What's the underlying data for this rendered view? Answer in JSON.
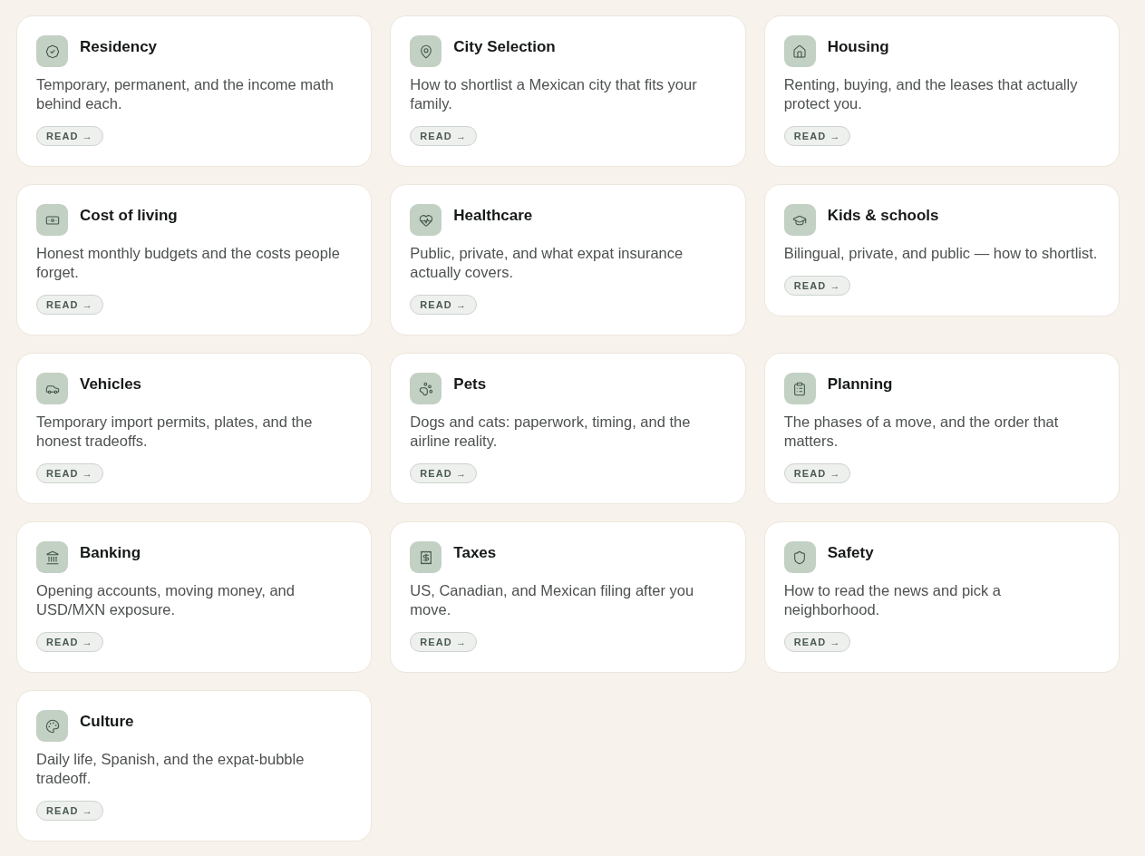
{
  "cards": [
    {
      "title": "Residency",
      "description": "Temporary, permanent, and the income math behind each.",
      "action": "READ →"
    },
    {
      "title": "City Selection",
      "description": "How to shortlist a Mexican city that fits your family.",
      "action": "READ →"
    },
    {
      "title": "Housing",
      "description": "Renting, buying, and the leases that actually protect you.",
      "action": "READ →"
    },
    {
      "title": "Cost of living",
      "description": "Honest monthly budgets and the costs people forget.",
      "action": "READ →"
    },
    {
      "title": "Healthcare",
      "description": "Public, private, and what expat insurance actually covers.",
      "action": "READ →"
    },
    {
      "title": "Kids & schools",
      "description": "Bilingual, private, and public — how to shortlist.",
      "action": "READ →"
    },
    {
      "title": "Vehicles",
      "description": "Temporary import permits, plates, and the honest tradeoffs.",
      "action": "READ →"
    },
    {
      "title": "Pets",
      "description": "Dogs and cats: paperwork, timing, and the airline reality.",
      "action": "READ →"
    },
    {
      "title": "Planning",
      "description": "The phases of a move, and the order that matters.",
      "action": "READ →"
    },
    {
      "title": "Banking",
      "description": "Opening accounts, moving money, and USD/MXN exposure.",
      "action": "READ →"
    },
    {
      "title": "Taxes",
      "description": "US, Canadian, and Mexican filing after you move.",
      "action": "READ →"
    },
    {
      "title": "Safety",
      "description": "How to read the news and pick a neighborhood.",
      "action": "READ →"
    },
    {
      "title": "Culture",
      "description": "Daily life, Spanish, and the expat-bubble tradeoff.",
      "action": "READ →"
    }
  ]
}
